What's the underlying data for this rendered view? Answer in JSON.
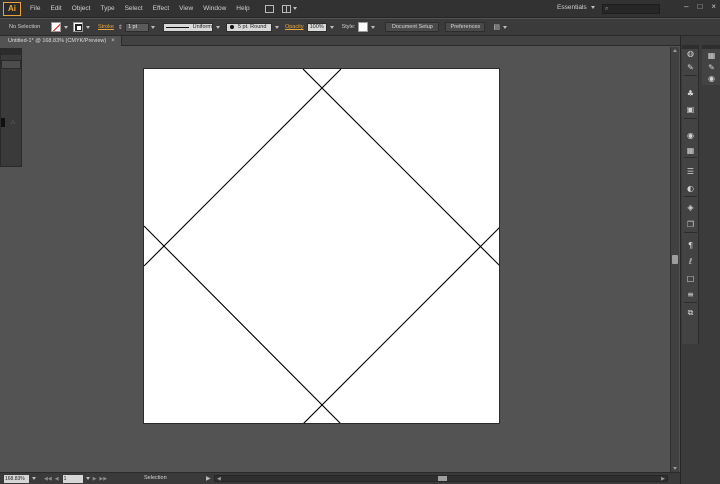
{
  "app": {
    "logo_text": "Ai",
    "accent_color": "#f0a531"
  },
  "menubar": {
    "items": [
      "File",
      "Edit",
      "Object",
      "Type",
      "Select",
      "Effect",
      "View",
      "Window",
      "Help"
    ],
    "workspace": "Essentials",
    "search_placeholder": ""
  },
  "controlbar": {
    "selection_status": "No Selection",
    "stroke_label": "Stroke",
    "stroke_weight": "1 pt",
    "stroke_profile": "Uniform",
    "brush": "5 pt. Round",
    "opacity_label": "Opacity",
    "opacity_value": "100%",
    "style_label": "Style:",
    "document_setup_label": "Document Setup",
    "preferences_label": "Preferences"
  },
  "document": {
    "tab_title": "Untitled-1* @ 168.83% (CMYK/Preview)",
    "tab_close": "×"
  },
  "statusbar": {
    "zoom": "168.83%",
    "page": "1",
    "tool": "Selection"
  },
  "icons": {
    "menu": [
      "bridge-icon",
      "arrange-documents-icon"
    ],
    "dock": [
      "color-guide-icon",
      "brushes-icon",
      "symbols-icon",
      "graphic-styles-icon",
      "color-icon",
      "swatches-icon",
      "stroke-icon",
      "appearance-icon",
      "layers-icon",
      "artboards-icon",
      "paragraph-icon",
      "opentype-icon",
      "transform-icon",
      "align-icon",
      "pathfinder-icon"
    ]
  }
}
